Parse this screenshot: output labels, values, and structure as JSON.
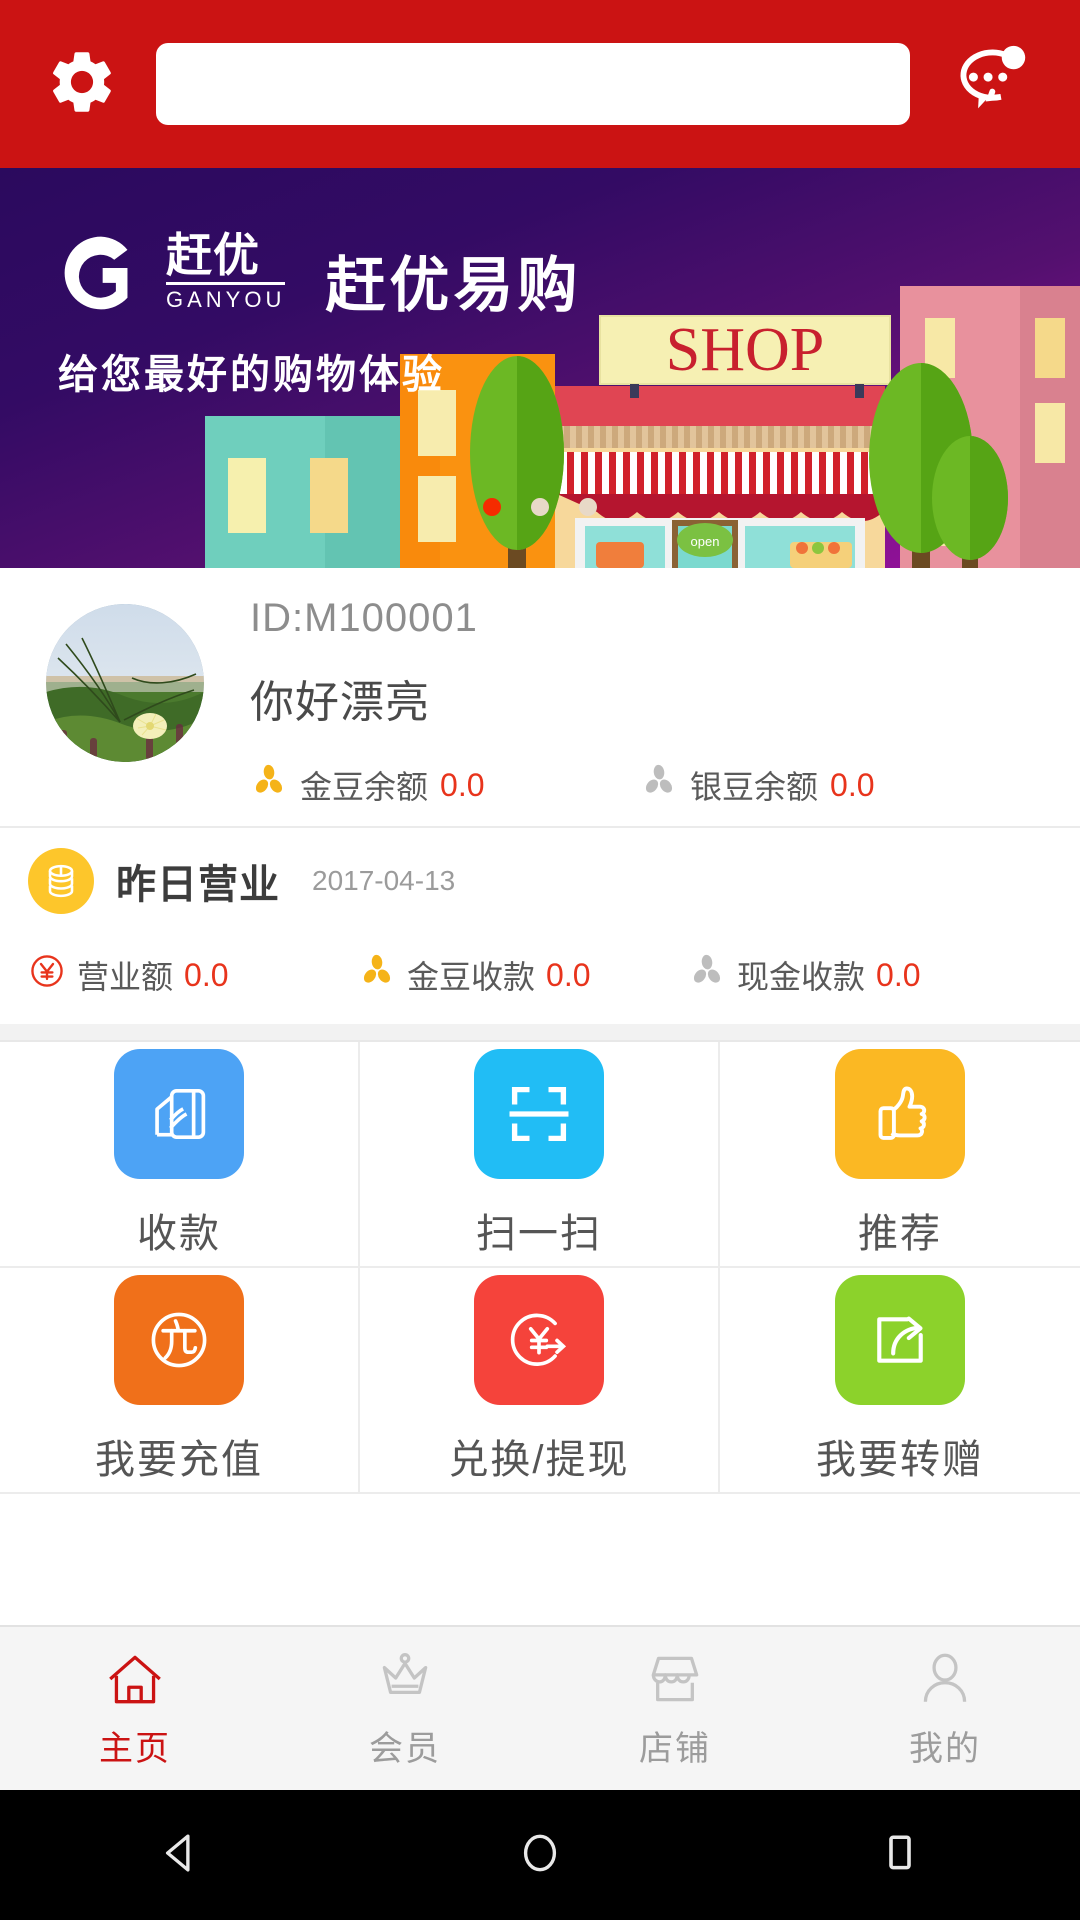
{
  "topbar": {
    "gear_icon": "gear-icon",
    "chat_icon": "chat-bubble-icon",
    "search_value": "",
    "search_placeholder": "",
    "bg_color": "#CB1313"
  },
  "banner": {
    "logo_cn_top": "赶优",
    "logo_cn_bottom": "GANYOU",
    "brand_name": "赶优易购",
    "tagline": "给您最好的购物体验",
    "shop_sign": "SHOP",
    "open_sign": "open",
    "dots": [
      {
        "active": true
      },
      {
        "active": false
      },
      {
        "active": false
      }
    ],
    "active_dot_color": "#F52B00",
    "inactive_dot_color": "#E8D9C7"
  },
  "profile": {
    "user_id": "ID:M100001",
    "nickname": "你好漂亮",
    "balances": [
      {
        "icon": "gold-bean-icon",
        "label": "金豆余额",
        "value": "0.0",
        "color": "#F5B318"
      },
      {
        "icon": "silver-bean-icon",
        "label": "银豆余额",
        "value": "0.0",
        "color": "#BDBDBD"
      }
    ],
    "value_color": "#E8341C"
  },
  "business": {
    "icon": "coin-stack-icon",
    "title": "昨日营业",
    "date": "2017-04-13",
    "stats": [
      {
        "icon": "yuan-circle-icon",
        "label": "营业额",
        "value": "0.0",
        "color": "#E8341C"
      },
      {
        "icon": "gold-bean-icon",
        "label": "金豆收款",
        "value": "0.0",
        "color": "#F5B318"
      },
      {
        "icon": "silver-bean-icon",
        "label": "现金收款",
        "value": "0.0",
        "color": "#BDBDBD"
      }
    ]
  },
  "grid": {
    "items": [
      {
        "label": "收款",
        "icon": "card-payment-icon",
        "color": "#4DA3F5"
      },
      {
        "label": "扫一扫",
        "icon": "qr-scan-icon",
        "color": "#21BDF5"
      },
      {
        "label": "推荐",
        "icon": "thumbs-up-icon",
        "color": "#FBB823"
      },
      {
        "label": "我要充值",
        "icon": "recharge-icon",
        "color": "#F0701A"
      },
      {
        "label": "兑换/提现",
        "icon": "withdraw-yuan-icon",
        "color": "#F5433B"
      },
      {
        "label": "我要转赠",
        "icon": "share-transfer-icon",
        "color": "#8CD22B"
      }
    ]
  },
  "tabbar": {
    "active_color": "#CB1313",
    "inactive_color": "#9C9C9C",
    "items": [
      {
        "label": "主页",
        "icon": "home-icon",
        "active": true
      },
      {
        "label": "会员",
        "icon": "crown-icon",
        "active": false
      },
      {
        "label": "店铺",
        "icon": "store-icon",
        "active": false
      },
      {
        "label": "我的",
        "icon": "person-icon",
        "active": false
      }
    ]
  },
  "sysnav": {
    "back_icon": "back-triangle-icon",
    "home_icon": "home-circle-icon",
    "recents_icon": "recents-square-icon"
  }
}
